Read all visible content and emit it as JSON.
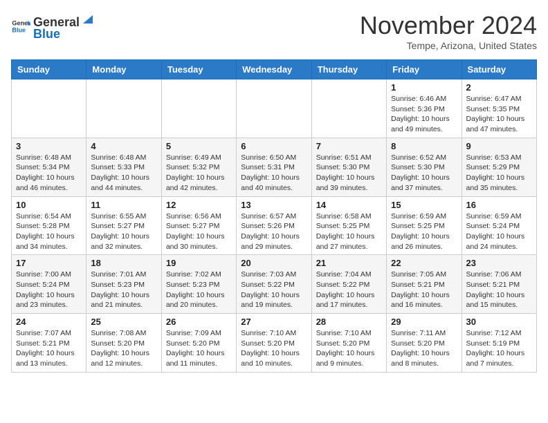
{
  "header": {
    "logo_general": "General",
    "logo_blue": "Blue",
    "month_title": "November 2024",
    "location": "Tempe, Arizona, United States"
  },
  "weekdays": [
    "Sunday",
    "Monday",
    "Tuesday",
    "Wednesday",
    "Thursday",
    "Friday",
    "Saturday"
  ],
  "weeks": [
    [
      {
        "day": "",
        "info": ""
      },
      {
        "day": "",
        "info": ""
      },
      {
        "day": "",
        "info": ""
      },
      {
        "day": "",
        "info": ""
      },
      {
        "day": "",
        "info": ""
      },
      {
        "day": "1",
        "info": "Sunrise: 6:46 AM\nSunset: 5:36 PM\nDaylight: 10 hours\nand 49 minutes."
      },
      {
        "day": "2",
        "info": "Sunrise: 6:47 AM\nSunset: 5:35 PM\nDaylight: 10 hours\nand 47 minutes."
      }
    ],
    [
      {
        "day": "3",
        "info": "Sunrise: 6:48 AM\nSunset: 5:34 PM\nDaylight: 10 hours\nand 46 minutes."
      },
      {
        "day": "4",
        "info": "Sunrise: 6:48 AM\nSunset: 5:33 PM\nDaylight: 10 hours\nand 44 minutes."
      },
      {
        "day": "5",
        "info": "Sunrise: 6:49 AM\nSunset: 5:32 PM\nDaylight: 10 hours\nand 42 minutes."
      },
      {
        "day": "6",
        "info": "Sunrise: 6:50 AM\nSunset: 5:31 PM\nDaylight: 10 hours\nand 40 minutes."
      },
      {
        "day": "7",
        "info": "Sunrise: 6:51 AM\nSunset: 5:30 PM\nDaylight: 10 hours\nand 39 minutes."
      },
      {
        "day": "8",
        "info": "Sunrise: 6:52 AM\nSunset: 5:30 PM\nDaylight: 10 hours\nand 37 minutes."
      },
      {
        "day": "9",
        "info": "Sunrise: 6:53 AM\nSunset: 5:29 PM\nDaylight: 10 hours\nand 35 minutes."
      }
    ],
    [
      {
        "day": "10",
        "info": "Sunrise: 6:54 AM\nSunset: 5:28 PM\nDaylight: 10 hours\nand 34 minutes."
      },
      {
        "day": "11",
        "info": "Sunrise: 6:55 AM\nSunset: 5:27 PM\nDaylight: 10 hours\nand 32 minutes."
      },
      {
        "day": "12",
        "info": "Sunrise: 6:56 AM\nSunset: 5:27 PM\nDaylight: 10 hours\nand 30 minutes."
      },
      {
        "day": "13",
        "info": "Sunrise: 6:57 AM\nSunset: 5:26 PM\nDaylight: 10 hours\nand 29 minutes."
      },
      {
        "day": "14",
        "info": "Sunrise: 6:58 AM\nSunset: 5:25 PM\nDaylight: 10 hours\nand 27 minutes."
      },
      {
        "day": "15",
        "info": "Sunrise: 6:59 AM\nSunset: 5:25 PM\nDaylight: 10 hours\nand 26 minutes."
      },
      {
        "day": "16",
        "info": "Sunrise: 6:59 AM\nSunset: 5:24 PM\nDaylight: 10 hours\nand 24 minutes."
      }
    ],
    [
      {
        "day": "17",
        "info": "Sunrise: 7:00 AM\nSunset: 5:24 PM\nDaylight: 10 hours\nand 23 minutes."
      },
      {
        "day": "18",
        "info": "Sunrise: 7:01 AM\nSunset: 5:23 PM\nDaylight: 10 hours\nand 21 minutes."
      },
      {
        "day": "19",
        "info": "Sunrise: 7:02 AM\nSunset: 5:23 PM\nDaylight: 10 hours\nand 20 minutes."
      },
      {
        "day": "20",
        "info": "Sunrise: 7:03 AM\nSunset: 5:22 PM\nDaylight: 10 hours\nand 19 minutes."
      },
      {
        "day": "21",
        "info": "Sunrise: 7:04 AM\nSunset: 5:22 PM\nDaylight: 10 hours\nand 17 minutes."
      },
      {
        "day": "22",
        "info": "Sunrise: 7:05 AM\nSunset: 5:21 PM\nDaylight: 10 hours\nand 16 minutes."
      },
      {
        "day": "23",
        "info": "Sunrise: 7:06 AM\nSunset: 5:21 PM\nDaylight: 10 hours\nand 15 minutes."
      }
    ],
    [
      {
        "day": "24",
        "info": "Sunrise: 7:07 AM\nSunset: 5:21 PM\nDaylight: 10 hours\nand 13 minutes."
      },
      {
        "day": "25",
        "info": "Sunrise: 7:08 AM\nSunset: 5:20 PM\nDaylight: 10 hours\nand 12 minutes."
      },
      {
        "day": "26",
        "info": "Sunrise: 7:09 AM\nSunset: 5:20 PM\nDaylight: 10 hours\nand 11 minutes."
      },
      {
        "day": "27",
        "info": "Sunrise: 7:10 AM\nSunset: 5:20 PM\nDaylight: 10 hours\nand 10 minutes."
      },
      {
        "day": "28",
        "info": "Sunrise: 7:10 AM\nSunset: 5:20 PM\nDaylight: 10 hours\nand 9 minutes."
      },
      {
        "day": "29",
        "info": "Sunrise: 7:11 AM\nSunset: 5:20 PM\nDaylight: 10 hours\nand 8 minutes."
      },
      {
        "day": "30",
        "info": "Sunrise: 7:12 AM\nSunset: 5:19 PM\nDaylight: 10 hours\nand 7 minutes."
      }
    ]
  ]
}
